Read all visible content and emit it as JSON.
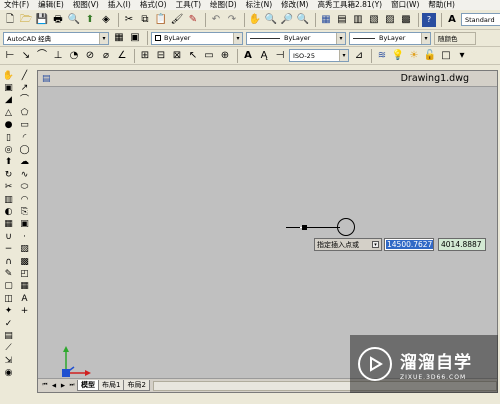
{
  "menubar": {
    "items": [
      "文件(F)",
      "编辑(E)",
      "视图(V)",
      "插入(I)",
      "格式(O)",
      "工具(T)",
      "绘图(D)",
      "标注(N)",
      "修改(M)",
      "高秀工具箱2.81(Y)",
      "窗口(W)",
      "帮助(H)"
    ]
  },
  "toolbar1": {
    "text_style_combo": "Standard"
  },
  "toolbar2": {
    "workspace_combo": "AutoCAD 经典",
    "layer_combo": "ByLayer",
    "linetype_combo": "ByLayer",
    "lineweight_combo": "ByLayer",
    "plotstyle_combo": "随颜色"
  },
  "toolbar3": {
    "dimstyle_combo": "ISO-25"
  },
  "drawing": {
    "title": "Drawing1.dwg",
    "prompt": "指定插入点或",
    "x_value": "14500.7627",
    "y_value": "4014.8887"
  },
  "layout_tabs": [
    "模型",
    "布局1",
    "布局2"
  ],
  "watermark": {
    "brand_cn": "溜溜自学",
    "brand_en": "ZIXUE.3D66.COM"
  },
  "colors": {
    "canvas_bg": "#c0c0c0",
    "selection": "#3169c6",
    "accent_blue": "#1f5fbf"
  },
  "icons": {
    "left_palette_1": [
      "line-icon",
      "construction-line-icon",
      "polyline-icon",
      "polygon-icon",
      "rectangle-icon",
      "arc-icon",
      "circle-icon",
      "revcloud-icon",
      "spline-icon",
      "ellipse-icon",
      "ellipse-arc-icon",
      "insert-block-icon",
      "make-block-icon",
      "point-icon",
      "hatch-icon",
      "gradient-icon",
      "region-icon",
      "table-icon",
      "mtext-icon",
      "add-selected-icon"
    ],
    "left_palette_0": [
      "pan-icon",
      "box-icon",
      "wedge-icon",
      "cone-icon",
      "sphere-icon",
      "cylinder-icon",
      "torus-icon",
      "extrude-icon",
      "revolve-icon",
      "slice-icon",
      "section-icon",
      "interfere-icon",
      "setup-icon",
      "union-icon",
      "subtract-icon",
      "intersect-icon",
      "edit-icon",
      "shell-icon",
      "separate-icon",
      "clean-icon",
      "check-icon",
      "imprint-icon",
      "taper-icon",
      "offset-face-icon",
      "color-icon"
    ]
  }
}
